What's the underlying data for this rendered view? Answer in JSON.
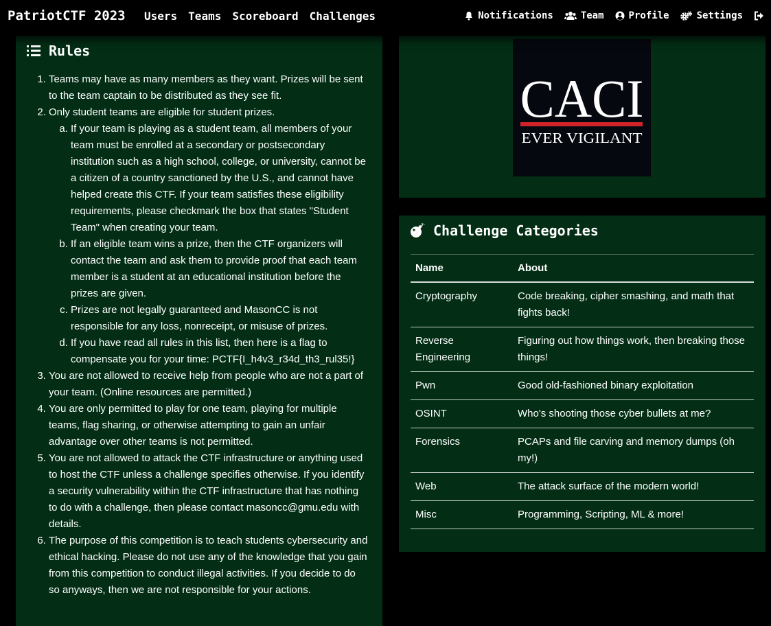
{
  "navbar": {
    "brand": "PatriotCTF 2023",
    "links": [
      "Users",
      "Teams",
      "Scoreboard",
      "Challenges"
    ],
    "right": {
      "notifications": "Notifications",
      "team": "Team",
      "profile": "Profile",
      "settings": "Settings"
    }
  },
  "rules": {
    "title": "Rules",
    "items": [
      "Teams may have as many members as they want. Prizes will be sent to the team captain to be distributed as they see fit.",
      "Only student teams are eligible for student prizes.",
      "You are not allowed to receive help from people who are not a part of your team. (Online resources are permitted.)",
      "You are only permitted to play for one team, playing for multiple teams, flag sharing, or otherwise attempting to gain an unfair advantage over other teams is not permitted.",
      "You are not allowed to attack the CTF infrastructure or anything used to host the CTF unless a challenge specifies otherwise. If you identify a security vulnerability within the CTF infrastructure that has nothing to do with a challenge, then please contact masoncc@gmu.edu with details.",
      "The purpose of this competition is to teach students cybersecurity and ethical hacking. Please do not use any of the knowledge that you gain from this competition to conduct illegal activities. If you decide to do so anyways, then we are not responsible for your actions."
    ],
    "sub_items": [
      "If your team is playing as a student team, all members of your team must be enrolled at a secondary or postsecondary institution such as a high school, college, or university, cannot be a citizen of a country sanctioned by the U.S., and cannot have helped create this CTF. If your team satisfies these eligibility requirements, please checkmark the box that states \"Student Team\" when creating your team.",
      "If an eligible team wins a prize, then the CTF organizers will contact the team and ask them to provide proof that each team member is a student at an educational institution before the prizes are given.",
      "Prizes are not legally guaranteed and MasonCC is not responsible for any loss, nonreceipt, or misuse of prizes.",
      "If you have read all rules in this list, then here is a flag to compensate you for your time: PCTF{I_h4v3_r34d_th3_rul35!}"
    ]
  },
  "sponsor": {
    "name": "CACI",
    "tagline": "EVER VIGILANT",
    "colors": {
      "bg": "#05080f",
      "bar": "#d2232a",
      "text": "#ffffff"
    }
  },
  "categories": {
    "title": "Challenge Categories",
    "headers": [
      "Name",
      "About"
    ],
    "rows": [
      {
        "name": "Cryptography",
        "about": "Code breaking, cipher smashing, and math that fights back!"
      },
      {
        "name": "Reverse Engineering",
        "about": "Figuring out how things work, then breaking those things!"
      },
      {
        "name": "Pwn",
        "about": "Good old-fashioned binary exploitation"
      },
      {
        "name": "OSINT",
        "about": "Who's shooting those cyber bullets at me?"
      },
      {
        "name": "Forensics",
        "about": "PCAPs and file carving and memory dumps (oh my!)"
      },
      {
        "name": "Web",
        "about": "The attack surface of the modern world!"
      },
      {
        "name": "Misc",
        "about": "Programming, Scripting, ML & more!"
      }
    ]
  },
  "colors": {
    "panel": "#032e15",
    "page": "#000000",
    "text": "#ffffff"
  }
}
